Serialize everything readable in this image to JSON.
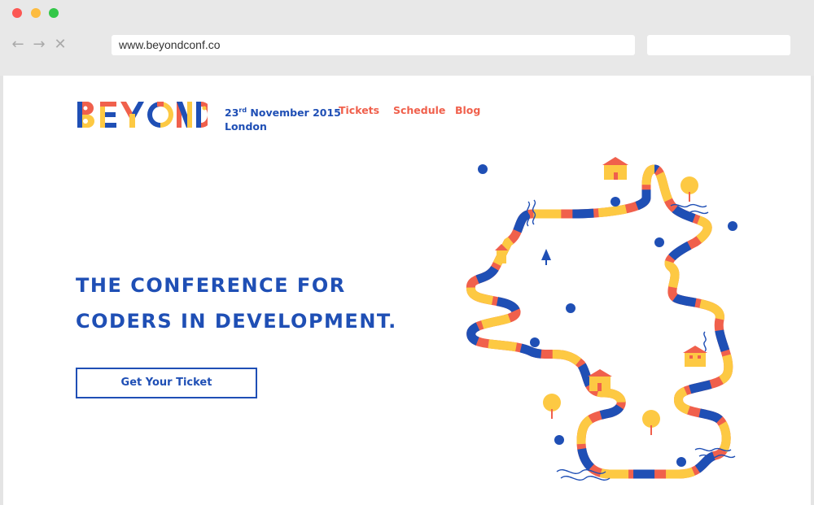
{
  "browser": {
    "url": "www.beyondconf.co",
    "nav_icons": [
      "back-arrow-icon",
      "forward-arrow-icon",
      "close-icon"
    ]
  },
  "site": {
    "logo_text": "BEYOND",
    "date_day": "23",
    "date_suffix": "rd",
    "date_rest": " November 2015",
    "location": "London",
    "nav": [
      "Tickets",
      "Schedule",
      "Blog"
    ]
  },
  "hero": {
    "line1": "THE CONFERENCE FOR",
    "line2": "CODERS IN DEVELOPMENT.",
    "cta": "Get Your Ticket"
  },
  "colors": {
    "blue": "#1f4fb5",
    "coral": "#f0604c",
    "yellow": "#fdc943"
  }
}
